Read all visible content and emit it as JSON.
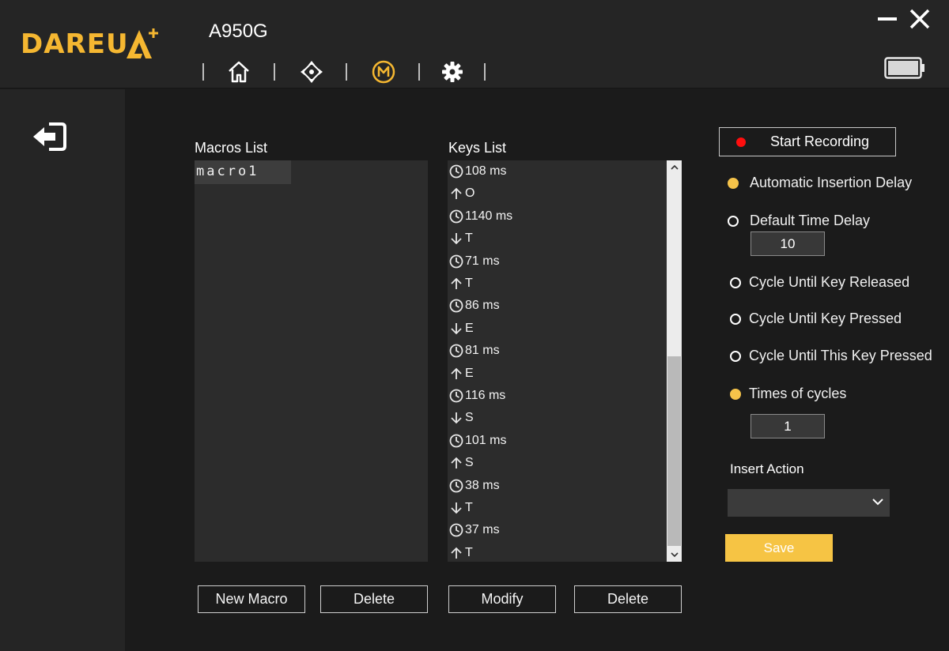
{
  "app": {
    "brand": "DAREU",
    "device_name": "A950G",
    "accent_color": "#f5b731",
    "nav_icons": [
      "home-icon",
      "move-icon",
      "macro-icon",
      "gear-icon"
    ]
  },
  "macros": {
    "label": "Macros List",
    "items": [
      "macro1"
    ],
    "new_label": "New Macro",
    "delete_label": "Delete"
  },
  "keys": {
    "label": "Keys List",
    "items": [
      {
        "type": "delay",
        "text": "108 ms"
      },
      {
        "type": "up",
        "text": "O"
      },
      {
        "type": "delay",
        "text": "1140 ms"
      },
      {
        "type": "down",
        "text": "T"
      },
      {
        "type": "delay",
        "text": "71 ms"
      },
      {
        "type": "up",
        "text": "T"
      },
      {
        "type": "delay",
        "text": "86 ms"
      },
      {
        "type": "down",
        "text": "E"
      },
      {
        "type": "delay",
        "text": "81 ms"
      },
      {
        "type": "up",
        "text": "E"
      },
      {
        "type": "delay",
        "text": "116 ms"
      },
      {
        "type": "down",
        "text": "S"
      },
      {
        "type": "delay",
        "text": "101 ms"
      },
      {
        "type": "up",
        "text": "S"
      },
      {
        "type": "delay",
        "text": "38 ms"
      },
      {
        "type": "down",
        "text": "T"
      },
      {
        "type": "delay",
        "text": "37 ms"
      },
      {
        "type": "up",
        "text": "T"
      }
    ],
    "modify_label": "Modify",
    "delete_label": "Delete"
  },
  "panel": {
    "record_label": "Start Recording",
    "record_color": "#ff0e0e",
    "auto_delay_label": "Automatic Insertion Delay",
    "auto_delay_selected": true,
    "default_delay_label": "Default Time Delay",
    "default_delay_selected": false,
    "default_delay_value": "10",
    "cycle_released_label": "Cycle Until Key Released",
    "cycle_pressed_label": "Cycle Until Key Pressed",
    "cycle_this_label": "Cycle Until This Key Pressed",
    "times_label": "Times of cycles",
    "times_selected": true,
    "times_value": "1",
    "insert_label": "Insert Action",
    "insert_value": "",
    "save_label": "Save",
    "save_color": "#f6c444"
  }
}
